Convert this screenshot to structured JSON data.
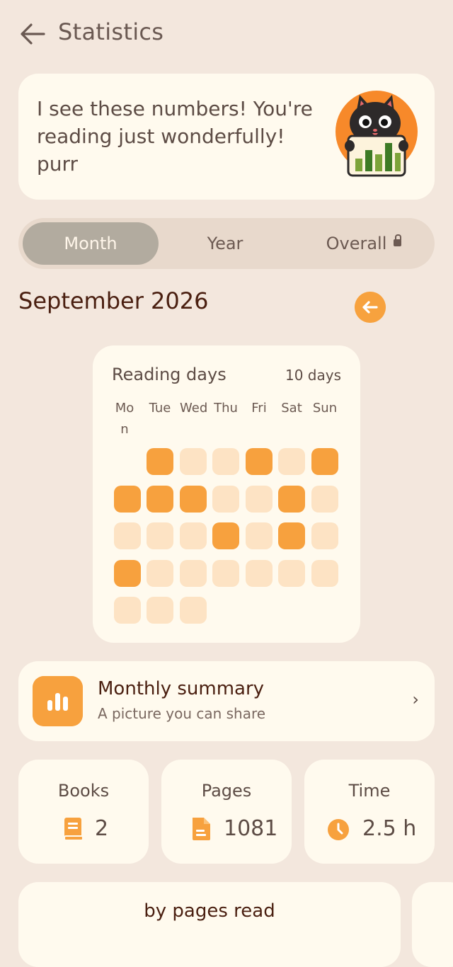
{
  "header": {
    "title": "Statistics"
  },
  "speech": {
    "text": "I see these numbers! You're reading just wonderfully! purr"
  },
  "tabs": {
    "month": "Month",
    "year": "Year",
    "overall": "Overall"
  },
  "month_heading": "September 2026",
  "reading_days": {
    "title": "Reading days",
    "count": "10 days",
    "weekdays": [
      "Mon",
      "Tue",
      "Wed",
      "Thu",
      "Fri",
      "Sat",
      "Sun"
    ],
    "read_days": [
      1,
      4,
      6,
      7,
      8,
      9,
      12,
      17,
      19,
      21
    ]
  },
  "summary": {
    "title": "Monthly summary",
    "subtitle": "A picture you can share",
    "chevron": "›"
  },
  "stats": {
    "books": {
      "label": "Books",
      "value": "2"
    },
    "pages": {
      "label": "Pages",
      "value": "1081"
    },
    "time": {
      "label": "Time",
      "value": "2.5 h"
    }
  },
  "bottom_card": {
    "title": "by pages read"
  },
  "colors": {
    "accent": "#f7a13e",
    "light_cell": "#fde3c4",
    "card": "#fffaee",
    "background": "#f3e7dd"
  }
}
